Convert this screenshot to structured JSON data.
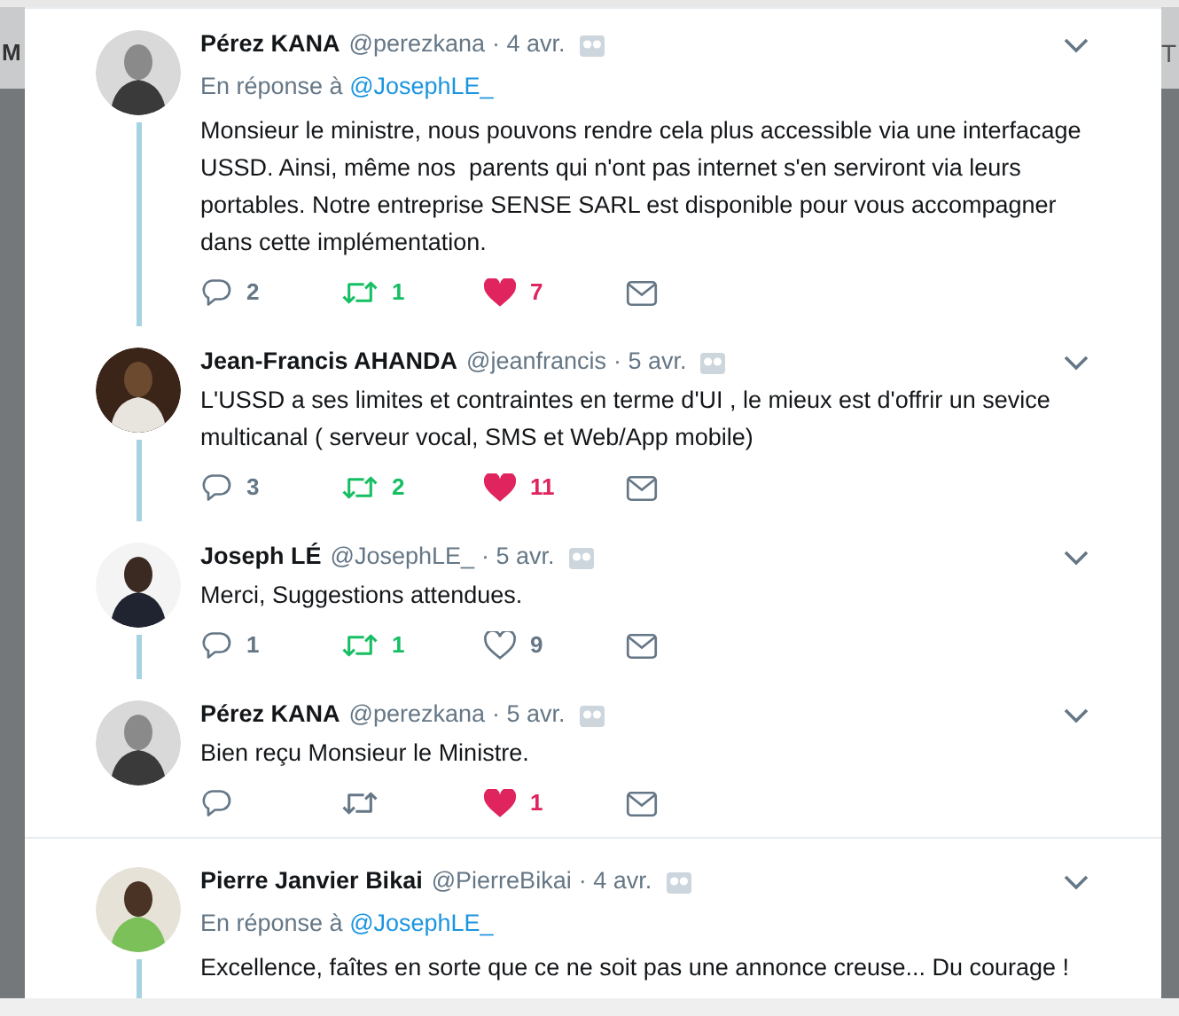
{
  "background": {
    "left_fragment": "M",
    "right_fragment": "T"
  },
  "tweets": [
    {
      "name": "Pérez KANA",
      "handle": "@perezkana",
      "date": "· 4 avr.",
      "reply_to": {
        "prefix": "En réponse à",
        "handle": "@JosephLE_"
      },
      "text": "Monsieur le ministre, nous pouvons rendre cela plus accessible via une interfacage USSD. Ainsi, même nos  parents qui n'ont pas internet s'en serviront via leurs portables. Notre entreprise SENSE SARL est disponible pour vous accompagner dans cette implémentation.",
      "replies": "2",
      "retweets": "1",
      "retweeted": true,
      "likes": "7",
      "liked": true,
      "thread_line_below": true
    },
    {
      "name": "Jean-Francis AHANDA",
      "handle": "@jeanfrancis",
      "date": "· 5 avr.",
      "text": "L'USSD a ses limites et contraintes en terme d'UI , le mieux est d'offrir un sevice multicanal ( serveur vocal, SMS et Web/App mobile)",
      "replies": "3",
      "retweets": "2",
      "retweeted": true,
      "likes": "11",
      "liked": true,
      "thread_line_below": true
    },
    {
      "name": "Joseph LÉ",
      "handle": "@JosephLE_",
      "date": "· 5 avr.",
      "text": "Merci, Suggestions attendues.",
      "replies": "1",
      "retweets": "1",
      "retweeted": true,
      "likes": "9",
      "liked": false,
      "thread_line_below": true
    },
    {
      "name": "Pérez KANA",
      "handle": "@perezkana",
      "date": "· 5 avr.",
      "text": "Bien reçu Monsieur le Ministre.",
      "retweeted": false,
      "likes": "1",
      "liked": true,
      "thread_line_below": false
    },
    {
      "name": "Pierre Janvier Bikai",
      "handle": "@PierreBikai",
      "date": "· 4 avr.",
      "reply_to": {
        "prefix": "En réponse à",
        "handle": "@JosephLE_"
      },
      "text": "Excellence, faîtes en sorte que ce ne soit pas une annonce creuse... Du courage !",
      "thread_line_below": true
    }
  ]
}
